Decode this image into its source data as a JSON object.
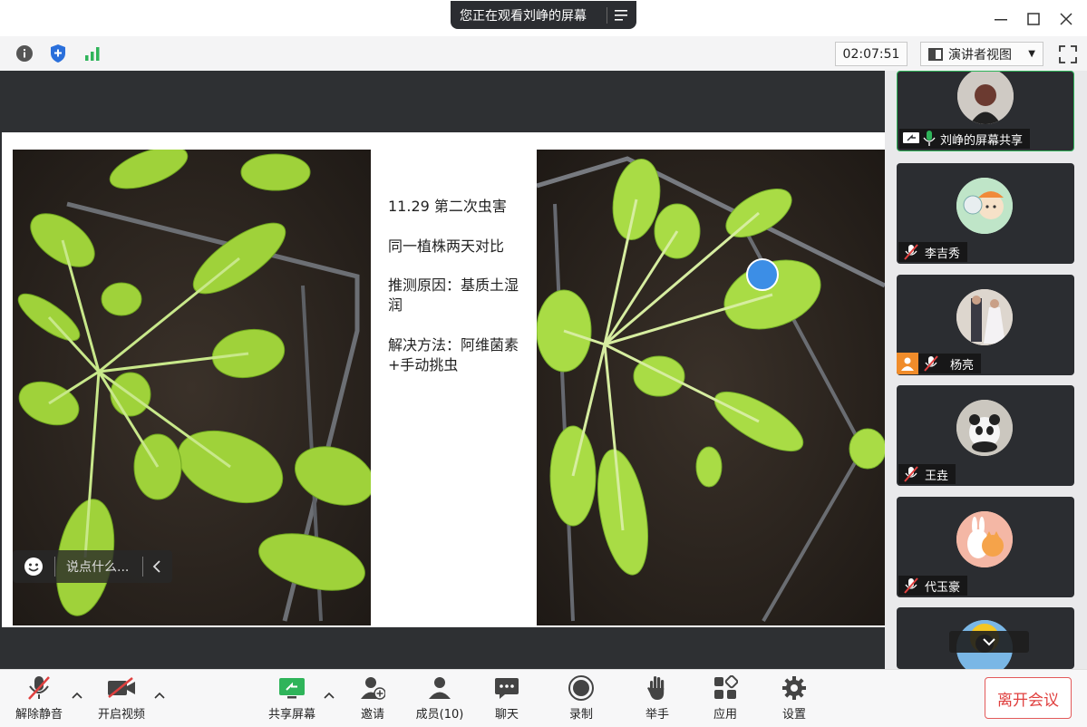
{
  "window": {
    "share_banner": "您正在观看刘峥的屏幕"
  },
  "toolbar": {
    "timer": "02:07:51",
    "view_mode": "演讲者视图"
  },
  "slide": {
    "lines": [
      "11.29 第二次虫害",
      "同一植株两天对比",
      "推测原因：基质土湿润",
      "解决方法：阿维菌素+手动挑虫"
    ]
  },
  "chat": {
    "placeholder": "说点什么..."
  },
  "participants": [
    {
      "name": "刘峥的屏幕共享",
      "mic": "on",
      "sharing": true,
      "active": true
    },
    {
      "name": "李吉秀",
      "mic": "off"
    },
    {
      "name": "杨亮",
      "mic": "off",
      "host_badge": true
    },
    {
      "name": "王垚",
      "mic": "off"
    },
    {
      "name": "代玉豪",
      "mic": "off"
    }
  ],
  "bottombar": {
    "mute": "解除静音",
    "video": "开启视频",
    "share": "共享屏幕",
    "invite": "邀请",
    "members": "成员(10)",
    "chat": "聊天",
    "record": "录制",
    "raise_hand": "举手",
    "apps": "应用",
    "settings": "设置",
    "leave": "离开会议"
  },
  "colors": {
    "accent_green": "#2fb45a",
    "leave_red": "#e0403f",
    "share_bg": "#2e3033"
  }
}
